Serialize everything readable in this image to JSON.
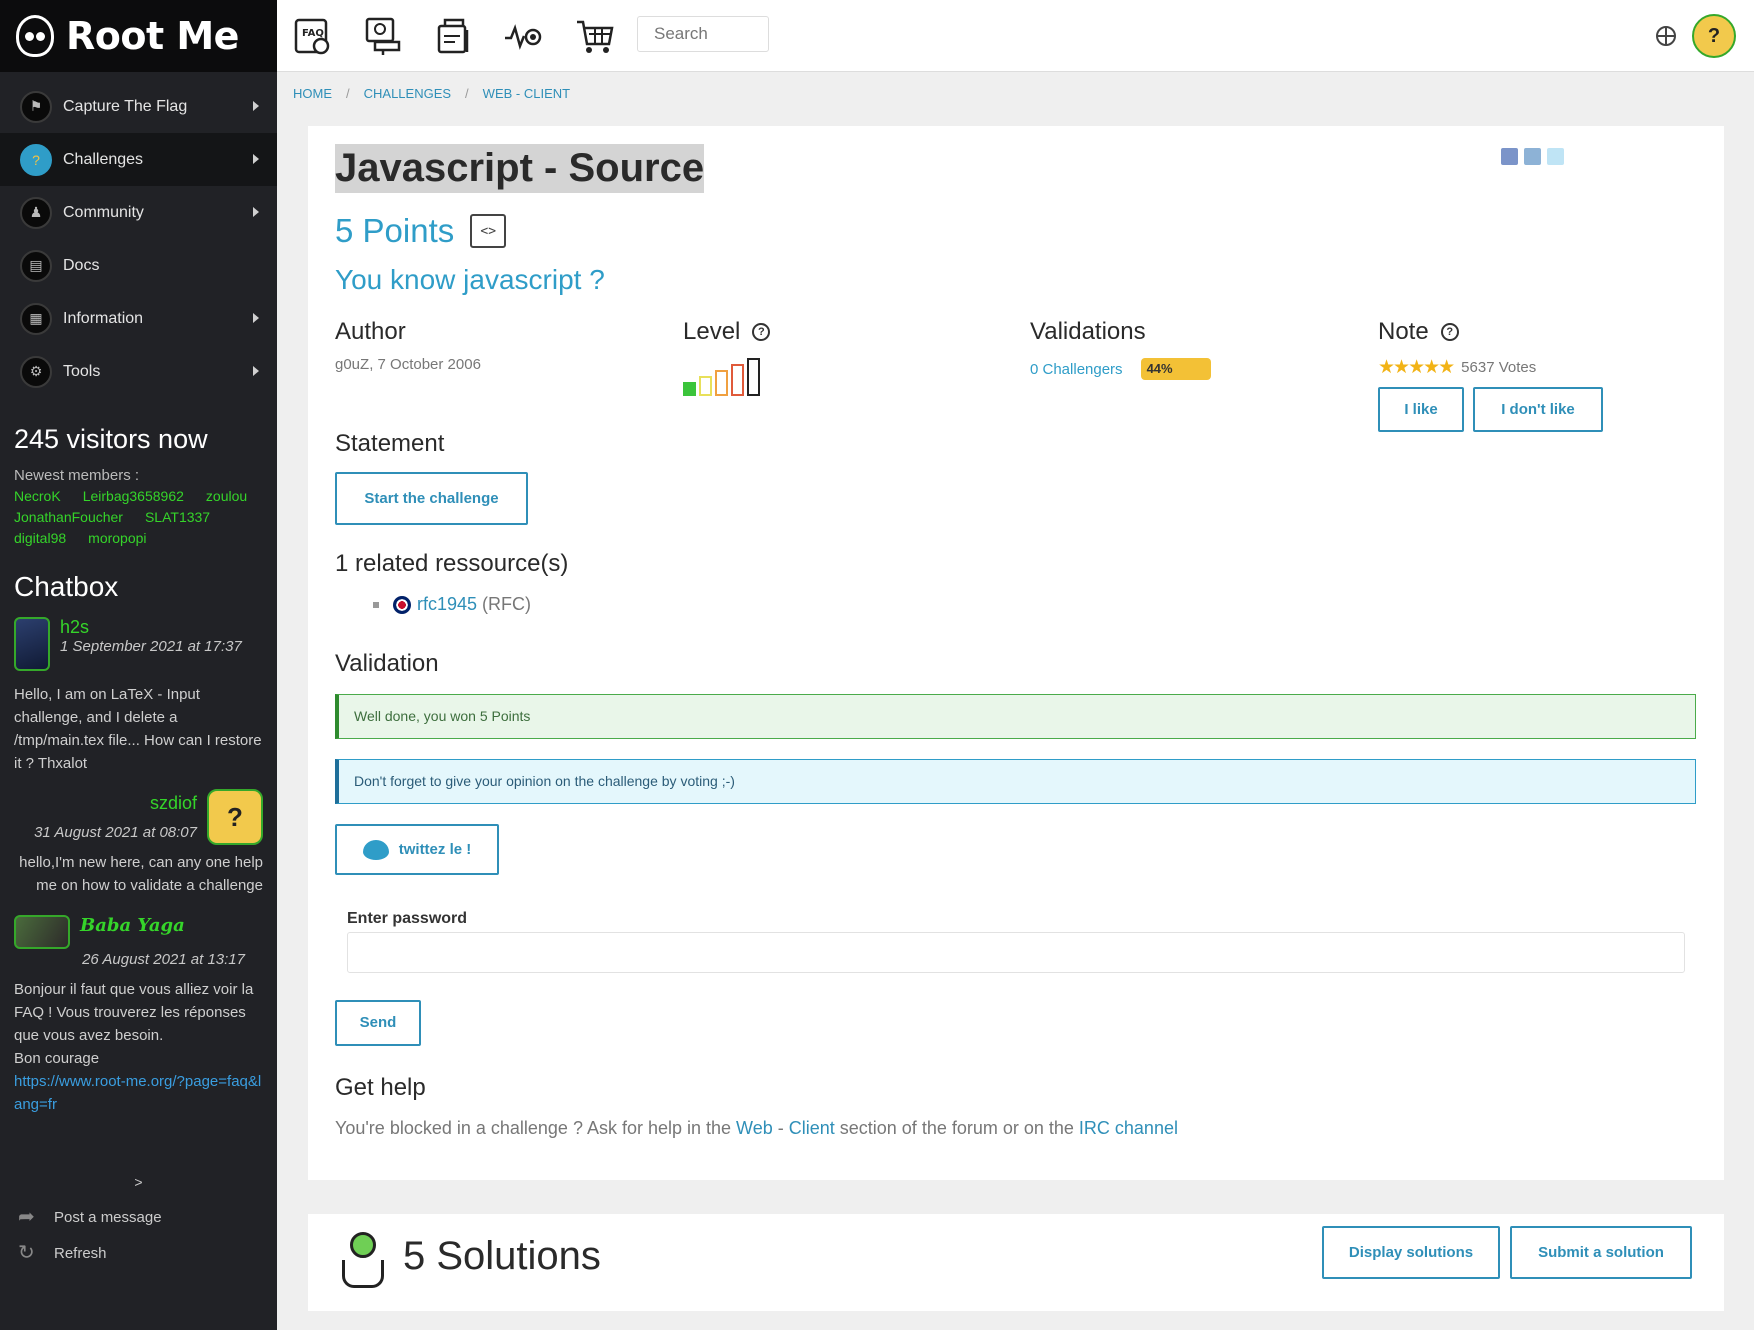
{
  "sidebar": {
    "logo_text": "Root Me",
    "nav": [
      {
        "label": "Capture The Flag",
        "icon": "flag-icon",
        "arrow": true
      },
      {
        "label": "Challenges",
        "icon": "challenges-icon",
        "arrow": true
      },
      {
        "label": "Community",
        "icon": "community-icon",
        "arrow": true
      },
      {
        "label": "Docs",
        "icon": "docs-icon",
        "arrow": false
      },
      {
        "label": "Information",
        "icon": "information-icon",
        "arrow": true
      },
      {
        "label": "Tools",
        "icon": "tools-icon",
        "arrow": true
      }
    ],
    "visitors": "245 visitors now",
    "newest_label": "Newest members :",
    "members": [
      "NecroK",
      "Leirbag3658962",
      "zoulou",
      "JonathanFoucher",
      "SLAT1337",
      "digital98",
      "moropopi"
    ],
    "chatbox_title": "Chatbox",
    "messages": [
      {
        "user": "h2s",
        "date": "1 September 2021 at 17:37",
        "text": "Hello, I am on LaTeX - Input challenge, and I delete a /tmp/main.tex file... How can I restore it ? Thxalot"
      },
      {
        "user": "szdiof",
        "date": "31 August 2021 at 08:07",
        "text": "hello,I'm new here, can any one help me on how to validate a challenge"
      },
      {
        "user": "Baba Yaga",
        "date": "26 August 2021 at 13:17",
        "text": "Bonjour il faut que vous alliez voir la FAQ ! Vous trouverez les réponses que vous avez besoin.",
        "text2": "Bon courage",
        "link": "https://www.root-me.org/?page=faq&lang=fr"
      }
    ],
    "chat_next": ">",
    "post_message": "Post a message",
    "refresh": "Refresh"
  },
  "topbar": {
    "icons": [
      "faq-icon",
      "challenges-board-icon",
      "documents-icon",
      "radar-icon",
      "cart-icon"
    ],
    "search_placeholder": "Search"
  },
  "breadcrumb": [
    "HOME",
    "CHALLENGES",
    "WEB - CLIENT"
  ],
  "challenge": {
    "title": "Javascript - Source",
    "points": "5 Points",
    "subtitle": "You know javascript ?",
    "author_label": "Author",
    "author_value": "g0uZ,  7 October 2006",
    "level_label": "Level",
    "level": 1,
    "level_max": 5,
    "validations_label": "Validations",
    "challengers": "0 Challengers",
    "validation_pct": "44%",
    "note_label": "Note",
    "stars": 5,
    "votes": "5637 Votes",
    "like": "I like",
    "dislike": "I don't like",
    "statement_label": "Statement",
    "start_button": "Start the challenge",
    "resources_label": "1 related ressource(s)",
    "resource_link": "rfc1945",
    "resource_suffix": "(RFC)",
    "validation_label": "Validation",
    "success_msg": "Well done, you won 5 Points",
    "info_msg": "Don't forget to give your opinion on the challenge by voting ;-)",
    "tweet_button": "twittez le !",
    "password_label": "Enter password",
    "send_button": "Send",
    "help_label": "Get help",
    "help_text_1": "You're blocked in a challenge ? Ask for help in the ",
    "help_link_1": "Web",
    "help_text_sep": " - ",
    "help_link_2": "Client",
    "help_text_2": " section of the forum or on the ",
    "help_link_3": "IRC channel"
  },
  "solutions": {
    "title": "5 Solutions",
    "display_button": "Display solutions",
    "submit_button": "Submit a solution"
  },
  "colors": {
    "accent": "#2f9dc8",
    "member_green": "#35d42a",
    "success_bg": "#e9f6e9",
    "info_bg": "#e4f7fc",
    "progress": "#f3c136"
  }
}
